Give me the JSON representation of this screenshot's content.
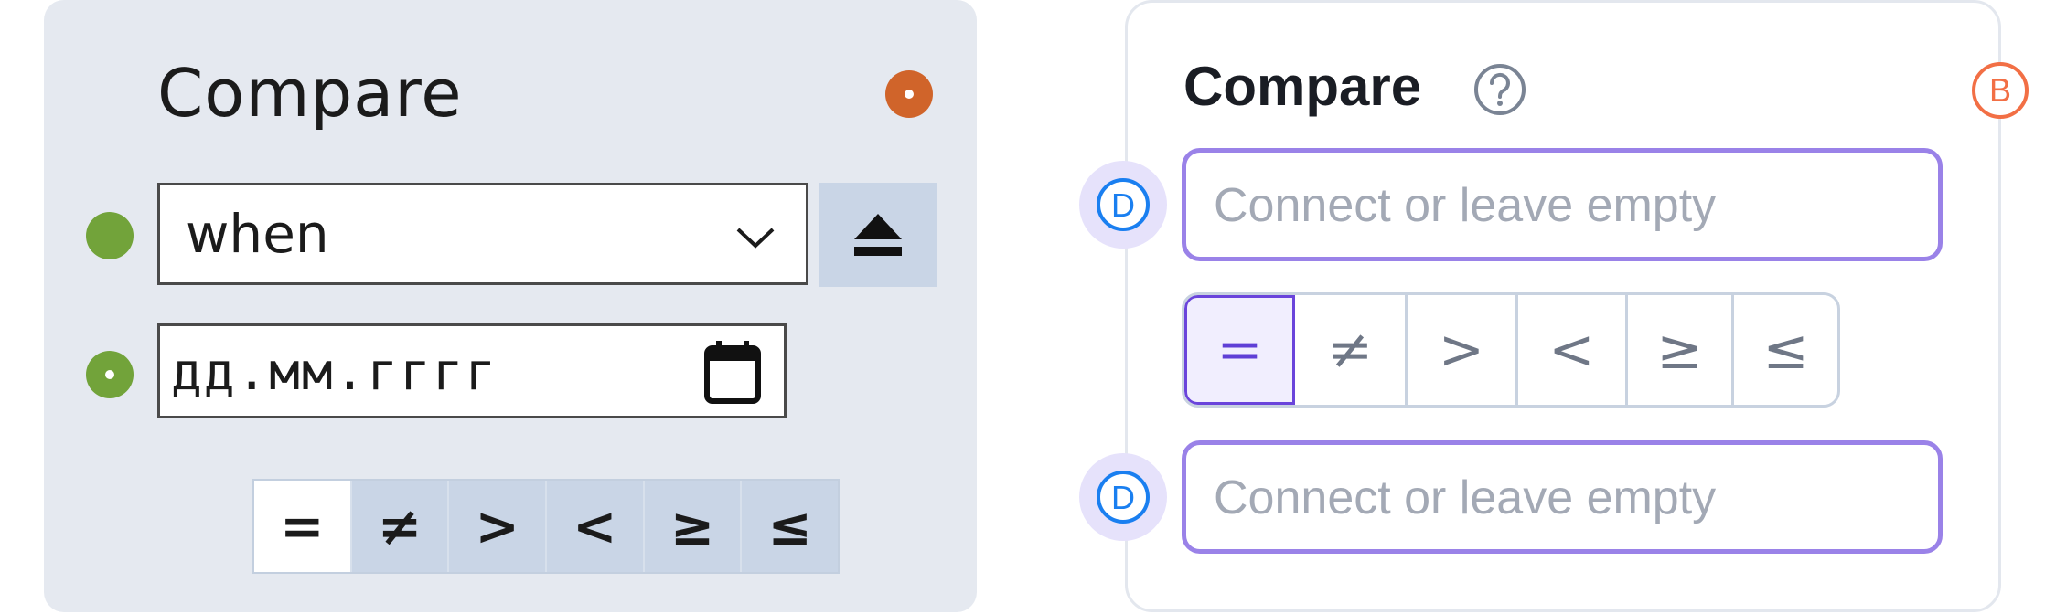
{
  "left_node": {
    "title": "Compare",
    "select": {
      "value": "when",
      "icon": "chevron-down-icon"
    },
    "date_input": {
      "placeholder": "дд.мм.гггг",
      "icon": "calendar-icon"
    },
    "operators": [
      "=",
      "≠",
      ">",
      "<",
      "≥",
      "≤"
    ],
    "selected_operator": "=",
    "colors": {
      "panel": "#e5e9f0",
      "output_port": "#d0642a",
      "input_port": "#72a33a",
      "operator_bar": "#c9d5e6"
    }
  },
  "right_node": {
    "title": "Compare",
    "help_icon": "question-circle-icon",
    "output_badge": "B",
    "input_badge": "D",
    "inputs": [
      {
        "placeholder": "Connect or leave empty"
      },
      {
        "placeholder": "Connect or leave empty"
      }
    ],
    "operators": [
      "=",
      "≠",
      ">",
      "<",
      "≥",
      "≤"
    ],
    "selected_operator": "=",
    "colors": {
      "accent": "#6a44db",
      "input_border": "#9a82e8",
      "badge_b": "#f26f45",
      "badge_d": "#1a7ff0",
      "badge_d_halo": "#e6e2fb"
    }
  }
}
